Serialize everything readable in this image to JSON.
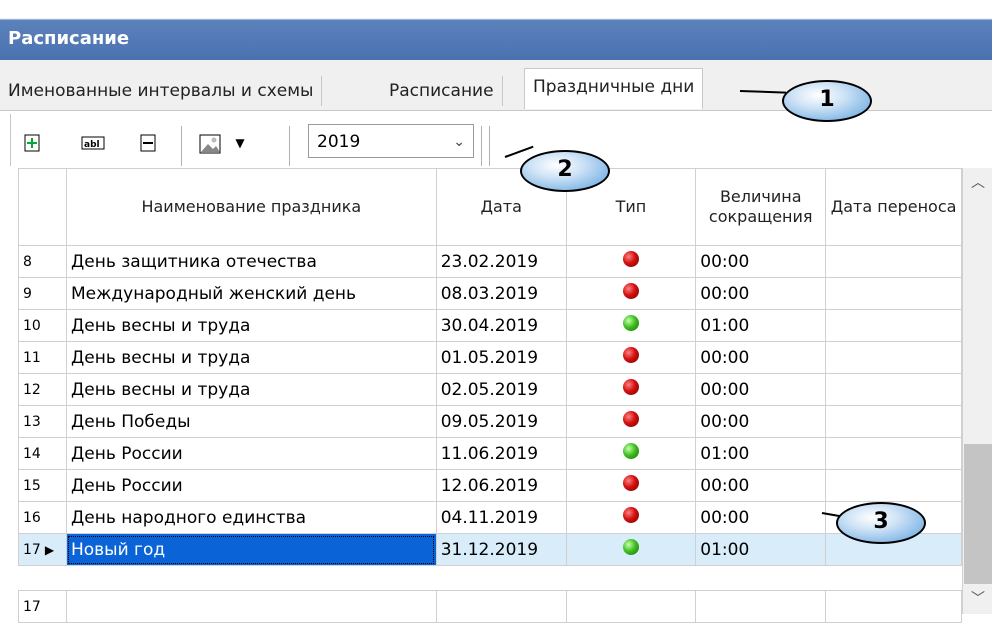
{
  "window": {
    "title": "Расписание"
  },
  "tabs": [
    {
      "label": "Именованные интервалы и схемы"
    },
    {
      "label": "Расписание"
    },
    {
      "label": "Праздничные дни"
    }
  ],
  "toolbar": {
    "add_icon": "add-row-icon",
    "edit_icon": "rename-icon",
    "delete_icon": "delete-row-icon",
    "export_icon": "image-export-icon",
    "year_value": "2019"
  },
  "table": {
    "columns": [
      "Наименование праздника",
      "Дата",
      "Тип",
      "Величина сокращения",
      "Дата переноса"
    ],
    "rows": [
      {
        "num": "8",
        "name": "День защитника отечества",
        "date": "23.02.2019",
        "type": "red",
        "reduction": "00:00",
        "transfer": ""
      },
      {
        "num": "9",
        "name": "Международный женский день",
        "date": "08.03.2019",
        "type": "red",
        "reduction": "00:00",
        "transfer": ""
      },
      {
        "num": "10",
        "name": "День весны и труда",
        "date": "30.04.2019",
        "type": "green",
        "reduction": "01:00",
        "transfer": ""
      },
      {
        "num": "11",
        "name": "День весны и труда",
        "date": "01.05.2019",
        "type": "red",
        "reduction": "00:00",
        "transfer": ""
      },
      {
        "num": "12",
        "name": "День весны и труда",
        "date": "02.05.2019",
        "type": "red",
        "reduction": "00:00",
        "transfer": ""
      },
      {
        "num": "13",
        "name": "День Победы",
        "date": "09.05.2019",
        "type": "red",
        "reduction": "00:00",
        "transfer": ""
      },
      {
        "num": "14",
        "name": "День России",
        "date": "11.06.2019",
        "type": "green",
        "reduction": "01:00",
        "transfer": ""
      },
      {
        "num": "15",
        "name": "День России",
        "date": "12.06.2019",
        "type": "red",
        "reduction": "00:00",
        "transfer": ""
      },
      {
        "num": "16",
        "name": "День народного единства",
        "date": "04.11.2019",
        "type": "red",
        "reduction": "00:00",
        "transfer": ""
      },
      {
        "num": "17",
        "name": "Новый год",
        "date": "31.12.2019",
        "type": "green",
        "reduction": "01:00",
        "transfer": ""
      }
    ],
    "footer_row_num": "17"
  },
  "callouts": [
    "1",
    "2",
    "3"
  ],
  "colors": {
    "title_bar": "#4a72b0",
    "selection": "#0a64d8",
    "selected_row": "#d9ecf9"
  }
}
